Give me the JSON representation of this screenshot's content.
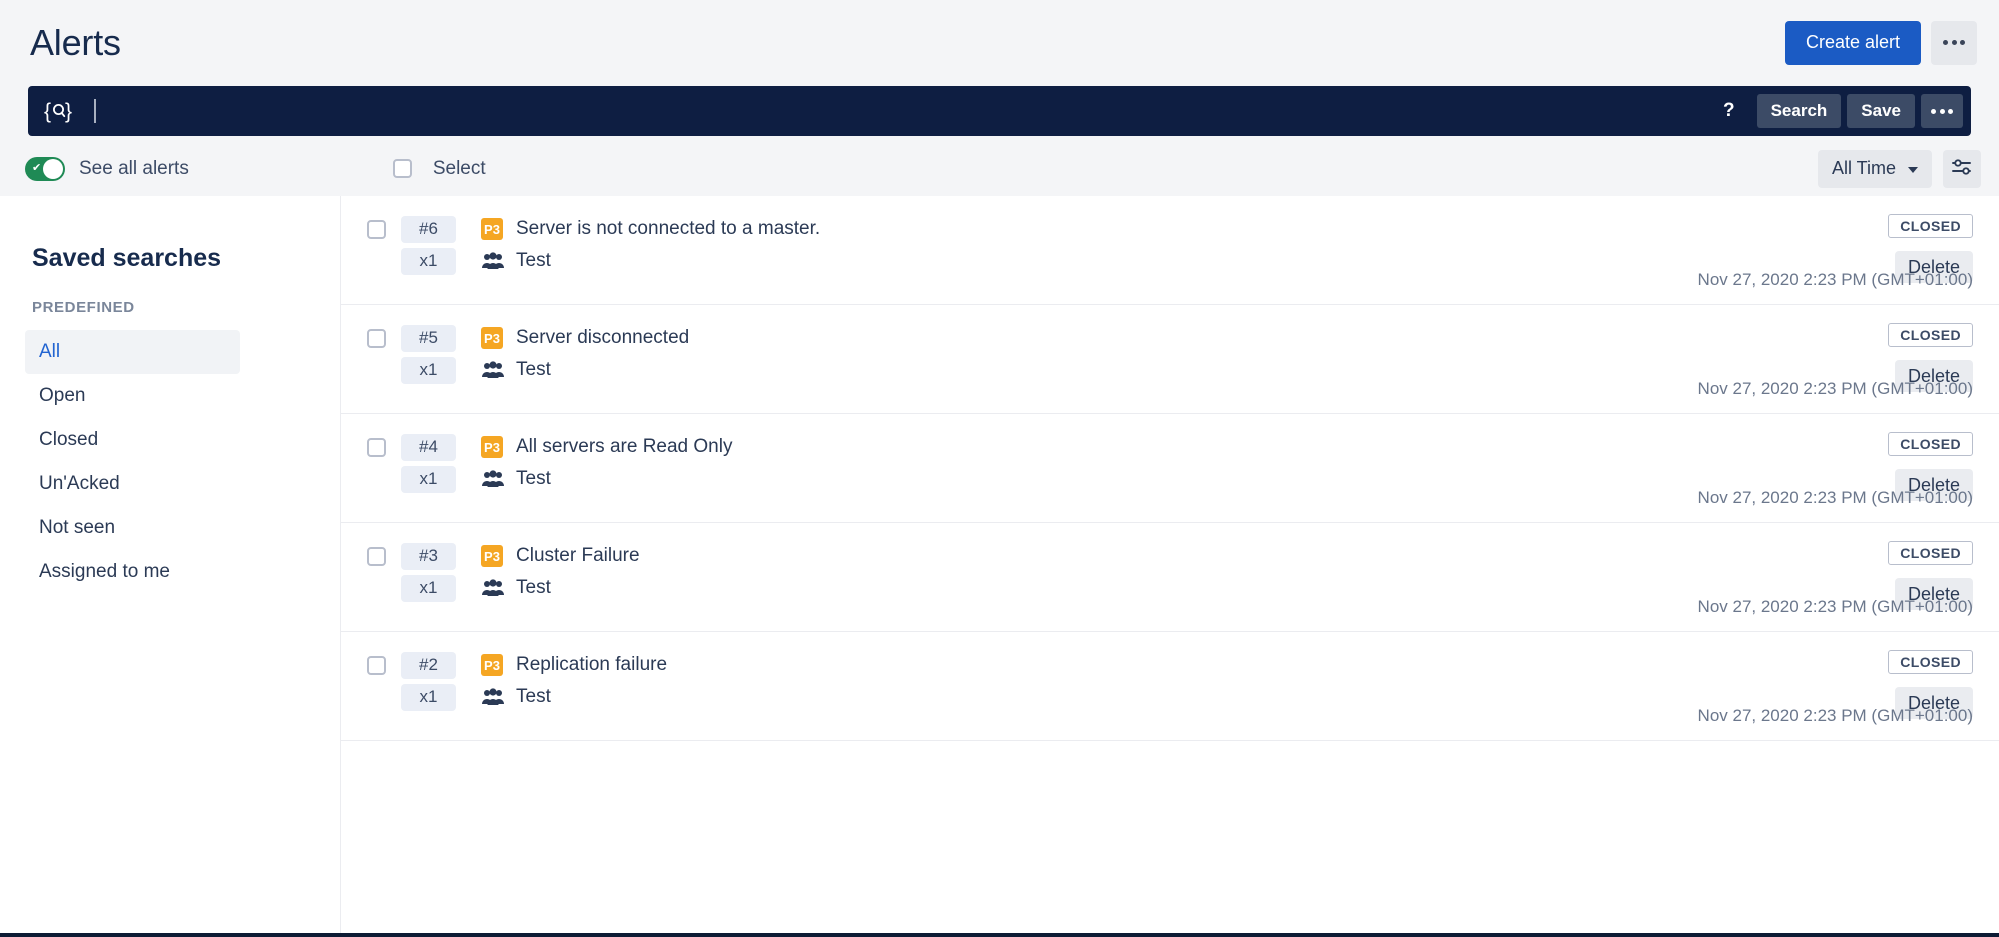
{
  "header": {
    "title": "Alerts",
    "create_button": "Create alert",
    "more_icon": "ellipsis-icon"
  },
  "search": {
    "query_icon": "query-search-icon",
    "value": "",
    "placeholder": "",
    "help_label": "?",
    "search_button": "Search",
    "save_button": "Save",
    "more_icon": "ellipsis-icon"
  },
  "toolbar": {
    "toggle_label": "See all alerts",
    "toggle_on": true,
    "select_label": "Select",
    "time_filter": "All Time",
    "filter_icon": "sliders-icon"
  },
  "sidebar": {
    "title": "Saved searches",
    "section_label": "PREDEFINED",
    "items": [
      {
        "label": "All",
        "active": true
      },
      {
        "label": "Open",
        "active": false
      },
      {
        "label": "Closed",
        "active": false
      },
      {
        "label": "Un'Acked",
        "active": false
      },
      {
        "label": "Not seen",
        "active": false
      },
      {
        "label": "Assigned to me",
        "active": false
      }
    ]
  },
  "alerts": [
    {
      "id": "#6",
      "priority": "P3",
      "title": "Server is not connected to a master.",
      "count": "x1",
      "team": "Test",
      "status": "CLOSED",
      "delete_label": "Delete",
      "time": "Nov 27, 2020 2:23 PM (GMT+01:00)"
    },
    {
      "id": "#5",
      "priority": "P3",
      "title": "Server disconnected",
      "count": "x1",
      "team": "Test",
      "status": "CLOSED",
      "delete_label": "Delete",
      "time": "Nov 27, 2020 2:23 PM (GMT+01:00)"
    },
    {
      "id": "#4",
      "priority": "P3",
      "title": "All servers are Read Only",
      "count": "x1",
      "team": "Test",
      "status": "CLOSED",
      "delete_label": "Delete",
      "time": "Nov 27, 2020 2:23 PM (GMT+01:00)"
    },
    {
      "id": "#3",
      "priority": "P3",
      "title": "Cluster Failure",
      "count": "x1",
      "team": "Test",
      "status": "CLOSED",
      "delete_label": "Delete",
      "time": "Nov 27, 2020 2:23 PM (GMT+01:00)"
    },
    {
      "id": "#2",
      "priority": "P3",
      "title": "Replication failure",
      "count": "x1",
      "team": "Test",
      "status": "CLOSED",
      "delete_label": "Delete",
      "time": "Nov 27, 2020 2:23 PM (GMT+01:00)"
    }
  ],
  "colors": {
    "accent_blue": "#1B5BC4",
    "search_bar_bg": "#0E1E42",
    "priority_orange": "#F5A623",
    "toggle_green": "#1F8A55",
    "link_blue": "#2264D1",
    "text_navy": "#172B4D"
  }
}
